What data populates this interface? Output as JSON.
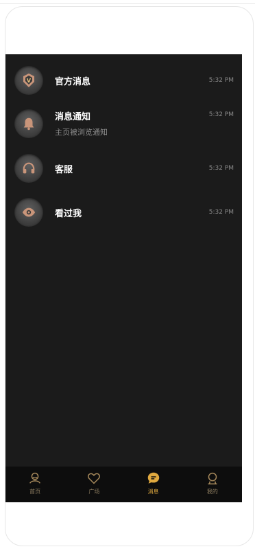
{
  "messages": [
    {
      "title": "官方消息",
      "subtitle": "",
      "time": "5:32 PM",
      "icon": "official-shield-icon"
    },
    {
      "title": "消息通知",
      "subtitle": "主页被浏览通知",
      "time": "5:32 PM",
      "icon": "bell-icon"
    },
    {
      "title": "客服",
      "subtitle": "",
      "time": "5:32 PM",
      "icon": "headset-icon"
    },
    {
      "title": "看过我",
      "subtitle": "",
      "time": "5:32 PM",
      "icon": "eye-icon"
    }
  ],
  "tabs": [
    {
      "label": "首页",
      "icon": "home-person-icon",
      "active": false
    },
    {
      "label": "广场",
      "icon": "heart-icon",
      "active": false
    },
    {
      "label": "消息",
      "icon": "message-bubble-icon",
      "active": true
    },
    {
      "label": "我的",
      "icon": "profile-icon",
      "active": false
    }
  ],
  "colors": {
    "background": "#1b1b1b",
    "tabbar": "#0d0d0d",
    "accent": "#e0a93f",
    "icon_bronze": "#c9957a"
  }
}
